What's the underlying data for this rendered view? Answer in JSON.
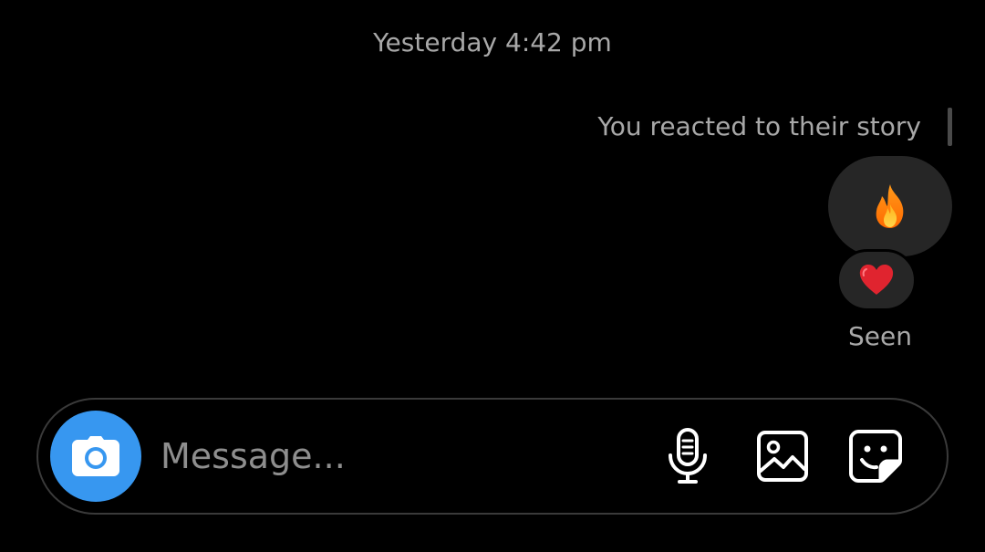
{
  "thread": {
    "timestamp": "Yesterday 4:42 pm",
    "story_reaction_text": "You reacted to their story",
    "reaction_emoji": "fire",
    "reaction_on_message": "heart",
    "seen_label": "Seen"
  },
  "composer": {
    "placeholder": "Message...",
    "value": "",
    "icons": {
      "camera": "camera-icon",
      "mic": "microphone-icon",
      "gallery": "image-icon",
      "sticker": "sticker-icon"
    }
  },
  "colors": {
    "background": "#000000",
    "bubble": "#262626",
    "muted_text": "#a8a8a8",
    "accent_blue": "#3797f0",
    "heart_red": "#e0242f",
    "fire_orange": "#ff7a00"
  }
}
